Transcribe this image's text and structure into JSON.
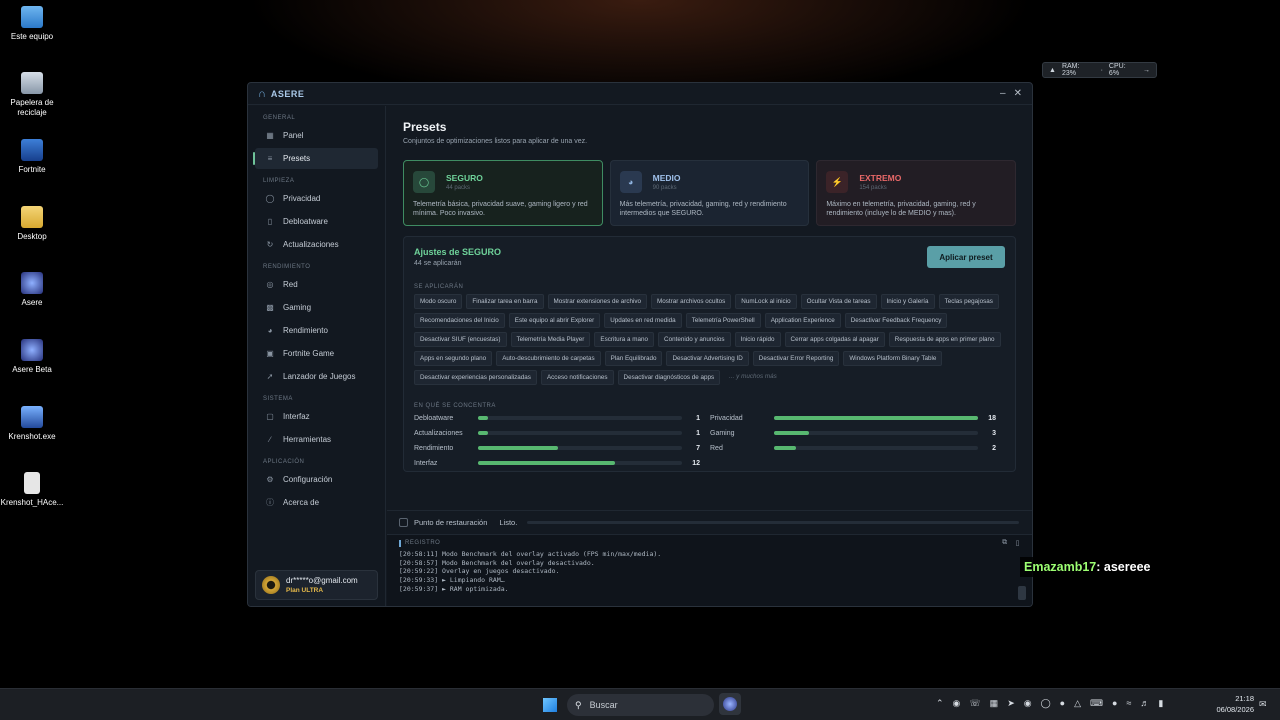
{
  "desktop": {
    "icons": [
      {
        "label": "Este equipo"
      },
      {
        "label": "Papelera de reciclaje"
      },
      {
        "label": "Fortnite"
      },
      {
        "label": "Desktop"
      },
      {
        "label": "Asere"
      },
      {
        "label": "Asere Beta"
      },
      {
        "label": "Krenshot.exe"
      },
      {
        "label": "Krenshot_HAce..."
      }
    ]
  },
  "perf_widget": {
    "ram": "RAM: 23%",
    "cpu": "CPU: 6%"
  },
  "window": {
    "title": "ASERE"
  },
  "sidebar": {
    "sections": {
      "general": "GENERAL",
      "limpieza": "LIMPIEZA",
      "rendimiento": "RENDIMIENTO",
      "sistema": "SISTEMA",
      "aplicacion": "APLICACIÓN"
    },
    "items": {
      "panel": "Panel",
      "presets": "Presets",
      "privacidad": "Privacidad",
      "debloatware": "Debloatware",
      "actualizaciones": "Actualizaciones",
      "red": "Red",
      "gaming": "Gaming",
      "rendimiento": "Rendimiento",
      "fortnite": "Fortnite Game",
      "lanzador": "Lanzador de Juegos",
      "interfaz": "Interfaz",
      "herramientas": "Herramientas",
      "configuracion": "Configuración",
      "acerca": "Acerca de"
    },
    "user": {
      "email": "dr*****o@gmail.com",
      "plan": "Plan ULTRA"
    }
  },
  "main": {
    "title": "Presets",
    "subtitle": "Conjuntos de optimizaciones listos para aplicar de una vez.",
    "cards": [
      {
        "name": "SEGURO",
        "count": "44 packs",
        "desc": "Telemetría básica, privacidad suave, gaming ligero y red mínima. Poco invasivo."
      },
      {
        "name": "MEDIO",
        "count": "90 packs",
        "desc": "Más telemetría, privacidad, gaming, red y rendimiento intermedios que SEGURO."
      },
      {
        "name": "EXTREMO",
        "count": "154 packs",
        "desc": "Máximo en telemetría, privacidad, gaming, red y rendimiento (incluye lo de MEDIO y mas)."
      }
    ],
    "panel": {
      "title": "Ajustes de SEGURO",
      "count": "44 se aplicarán",
      "apply_label": "Aplicar preset",
      "tags_label": "SE APLICARÁN",
      "tags": [
        "Modo oscuro",
        "Finalizar tarea en barra",
        "Mostrar extensiones de archivo",
        "Mostrar archivos ocultos",
        "NumLock al inicio",
        "Ocultar Vista de tareas",
        "Inicio y Galería",
        "Teclas pegajosas",
        "Recomendaciones del Inicio",
        "Este equipo al abrir Explorer",
        "Updates en red medida",
        "Telemetría PowerShell",
        "Application Experience",
        "Desactivar Feedback Frequency",
        "Desactivar SIUF (encuestas)",
        "Telemetría Media Player",
        "Escritura a mano",
        "Contenido y anuncios",
        "Inicio rápido",
        "Cerrar apps colgadas al apagar",
        "Respuesta de apps en primer plano",
        "Apps en segundo plano",
        "Auto-descubrimiento de carpetas",
        "Plan Equilibrado",
        "Desactivar Advertising ID",
        "Desactivar Error Reporting",
        "Windows Platform Binary Table",
        "Desactivar experiencias personalizadas",
        "Acceso notificaciones",
        "Desactivar diagnósticos de apps"
      ],
      "tags_more": "... y muchos más",
      "focus_label": "EN QUÉ SE CONCENTRA",
      "focus": [
        {
          "name": "Debloatware",
          "value": 1,
          "fill": 0.05
        },
        {
          "name": "Privacidad",
          "value": 18,
          "fill": 1.0
        },
        {
          "name": "Actualizaciones",
          "value": 1,
          "fill": 0.05
        },
        {
          "name": "Gaming",
          "value": 3,
          "fill": 0.17
        },
        {
          "name": "Rendimiento",
          "value": 7,
          "fill": 0.39
        },
        {
          "name": "Red",
          "value": 2,
          "fill": 0.11
        },
        {
          "name": "Interfaz",
          "value": 12,
          "fill": 0.67
        }
      ]
    }
  },
  "footer": {
    "restore_label": "Punto de restauración",
    "status": "Listo."
  },
  "log": {
    "header": "REGISTRO",
    "lines": [
      "[20:58:11] Modo Benchmark del overlay activado (FPS min/max/media).",
      "[20:58:57] Modo Benchmark del overlay desactivado.",
      "[20:59:22] Overlay en juegos desactivado.",
      "[20:59:33] ► Limpiando RAM…",
      "[20:59:37] ► RAM optimizada."
    ]
  },
  "twitch": {
    "user": "Emazamb17",
    "message": " : asereee"
  },
  "taskbar": {
    "search_placeholder": "Buscar",
    "time": "21:18",
    "date": "06/08/2026"
  }
}
